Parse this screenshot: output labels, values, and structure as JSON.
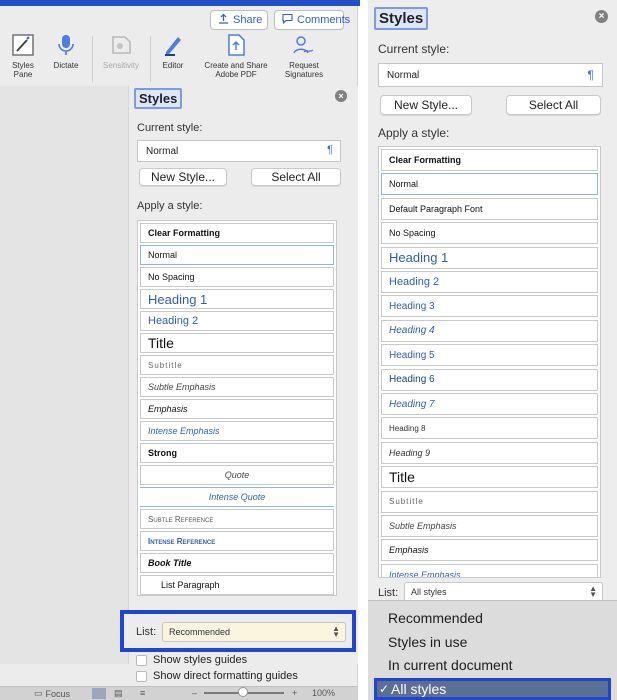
{
  "toolbar": {
    "share_label": "Share",
    "comments_label": "Comments",
    "items": [
      {
        "label": "Styles Pane",
        "icon": "styles-pane-icon"
      },
      {
        "label": "Dictate",
        "icon": "microphone-icon"
      },
      {
        "label": "Sensitivity",
        "icon": "sensitivity-icon"
      },
      {
        "label": "Editor",
        "icon": "editor-pen-icon"
      },
      {
        "label": "Create and Share Adobe PDF",
        "icon": "pdf-share-icon"
      },
      {
        "label": "Request Signatures",
        "icon": "signature-icon"
      }
    ]
  },
  "left_panel": {
    "title": "Styles",
    "current_style_label": "Current style:",
    "current_style_value": "Normal",
    "pilcrow": "¶",
    "new_style_label": "New Style...",
    "select_all_label": "Select All",
    "apply_label": "Apply a style:",
    "styles": [
      {
        "label": "Clear Formatting",
        "kind": "bold-small"
      },
      {
        "label": "Normal",
        "kind": "normal",
        "selected": true
      },
      {
        "label": "No Spacing",
        "kind": "normal"
      },
      {
        "label": "Heading 1",
        "kind": "h1"
      },
      {
        "label": "Heading 2",
        "kind": "h2"
      },
      {
        "label": "Title",
        "kind": "title"
      },
      {
        "label": "Subtitle",
        "kind": "subtitle"
      },
      {
        "label": "Subtle Emphasis",
        "kind": "subtle-emphasis"
      },
      {
        "label": "Emphasis",
        "kind": "emphasis"
      },
      {
        "label": "Intense Emphasis",
        "kind": "intense-emphasis"
      },
      {
        "label": "Strong",
        "kind": "strong"
      },
      {
        "label": "Quote",
        "kind": "quote"
      },
      {
        "label": "Intense Quote",
        "kind": "intense-quote"
      },
      {
        "label": "Subtle Reference",
        "kind": "subtle-reference"
      },
      {
        "label": "Intense Reference",
        "kind": "intense-reference"
      },
      {
        "label": "Book Title",
        "kind": "book-title"
      },
      {
        "label": "List Paragraph",
        "kind": "list-paragraph"
      }
    ],
    "list_label": "List:",
    "list_value": "Recommended",
    "show_guides": "Show styles guides",
    "show_direct": "Show direct formatting guides"
  },
  "status_bar": {
    "focus_label": "Focus",
    "zoom_minus": "–",
    "zoom_plus": "+",
    "zoom_level": "100%"
  },
  "right_panel": {
    "title": "Styles",
    "current_style_label": "Current style:",
    "current_style_value": "Normal",
    "pilcrow": "¶",
    "new_style_label": "New Style...",
    "select_all_label": "Select All",
    "apply_label": "Apply a style:",
    "styles": [
      {
        "label": "Clear Formatting",
        "kind": "bold-small"
      },
      {
        "label": "Normal",
        "kind": "normal",
        "selected": true
      },
      {
        "label": "Default Paragraph Font",
        "kind": "normal"
      },
      {
        "label": "No Spacing",
        "kind": "normal"
      },
      {
        "label": "Heading 1",
        "kind": "h1"
      },
      {
        "label": "Heading 2",
        "kind": "h2"
      },
      {
        "label": "Heading 3",
        "kind": "h3"
      },
      {
        "label": "Heading 4",
        "kind": "h4"
      },
      {
        "label": "Heading 5",
        "kind": "h3"
      },
      {
        "label": "Heading 6",
        "kind": "h6"
      },
      {
        "label": "Heading 7",
        "kind": "h4"
      },
      {
        "label": "Heading 8",
        "kind": "h8"
      },
      {
        "label": "Heading 9",
        "kind": "h9"
      },
      {
        "label": "Title",
        "kind": "title"
      },
      {
        "label": "Subtitle",
        "kind": "subtitle"
      },
      {
        "label": "Subtle Emphasis",
        "kind": "subtle-emphasis"
      },
      {
        "label": "Emphasis",
        "kind": "emphasis"
      },
      {
        "label": "Intense Emphasis",
        "kind": "intense-emphasis"
      }
    ],
    "list_label": "List:",
    "list_value": "All styles",
    "dropdown": [
      {
        "label": "Recommended",
        "chosen": false
      },
      {
        "label": "Styles in use",
        "chosen": false
      },
      {
        "label": "In current document",
        "chosen": false
      },
      {
        "label": "All styles",
        "chosen": true
      }
    ],
    "check_mark": "✓"
  },
  "colors": {
    "accent_blue": "#2b5fd9",
    "highlight_border": "#2045d1",
    "heading_blue": "#2f5fb3",
    "menu_selected": "#5b6e94"
  }
}
